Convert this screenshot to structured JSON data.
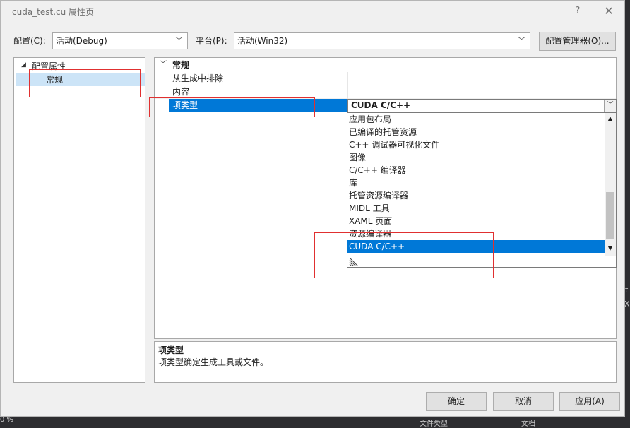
{
  "dialog": {
    "title": "cuda_test.cu 属性页",
    "help": "?",
    "close": "✕"
  },
  "toolbar": {
    "config_label": "配置(C):",
    "config_value": "活动(Debug)",
    "platform_label": "平台(P):",
    "platform_value": "活动(Win32)",
    "config_manager": "配置管理器(O)..."
  },
  "tree": {
    "root": "配置属性",
    "items": [
      {
        "label": "常规",
        "selected": true
      }
    ]
  },
  "grid": {
    "category": "常规",
    "rows": [
      {
        "name": "从生成中排除",
        "value": ""
      },
      {
        "name": "内容",
        "value": ""
      },
      {
        "name": "项类型",
        "value": "CUDA C/C++",
        "selected": true
      }
    ]
  },
  "dropdown": {
    "items": [
      "应用包布局",
      "已编译的托管资源",
      "C++ 调试器可视化文件",
      "图像",
      "C/C++ 编译器",
      "库",
      "托管资源编译器",
      "MIDL 工具",
      "XAML 页面",
      "资源编译器",
      "CUDA C/C++"
    ],
    "selected": "CUDA C/C++"
  },
  "description": {
    "title": "项类型",
    "text": "项类型确定生成工具或文件。"
  },
  "footer": {
    "ok": "确定",
    "cancel": "取消",
    "apply": "应用(A)"
  },
  "background_fragments": {
    "bottom_left": "0 %",
    "bottom_mid": "文件类型",
    "bottom_right": "文档",
    "right_edge_1": "t",
    "right_edge_2": "X"
  },
  "colors": {
    "selection_blue": "#0078d7",
    "tree_selection": "#cce4f7",
    "annotation_red": "#e03030"
  }
}
